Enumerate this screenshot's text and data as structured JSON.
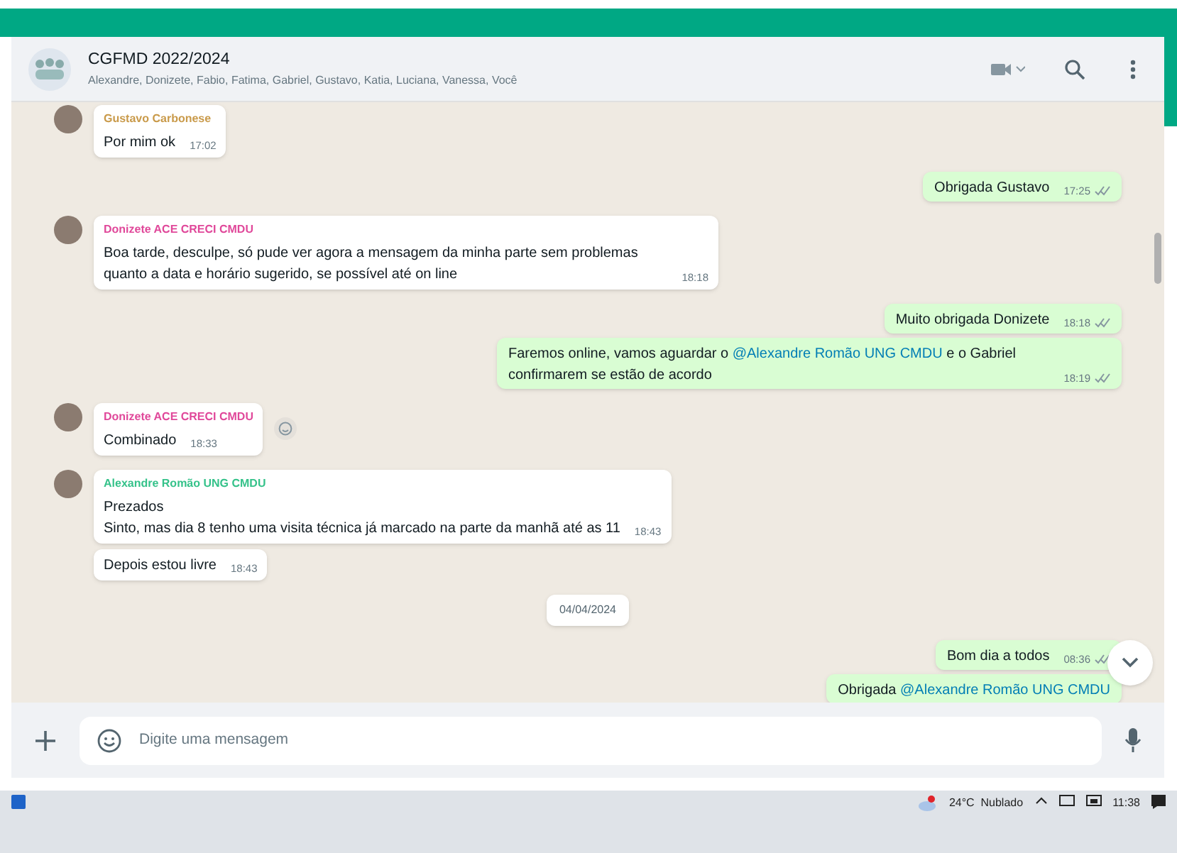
{
  "chat": {
    "title": "CGFMD 2022/2024",
    "members": "Alexandre, Donizete, Fabio, Fatima, Gabriel, Gustavo, Katia, Luciana, Vanessa, Você"
  },
  "messages": [
    {
      "kind": "incoming",
      "sender": "Gustavo Carbonese",
      "color": "#c99a4a",
      "avatar": true,
      "lines": [
        "Por mim ok"
      ],
      "time": "17:02",
      "reaction": false
    },
    {
      "kind": "outgoing",
      "parts": [
        {
          "kind": "plain",
          "text": "Obrigada Gustavo"
        }
      ],
      "time": "17:25"
    },
    {
      "kind": "incoming",
      "sender": "Donizete ACE CRECI CMDU",
      "color": "#e0489a",
      "avatar": true,
      "lines": [
        "Boa tarde, desculpe, só pude ver agora a mensagem da minha parte sem problemas quanto a data e horário sugerido, se possível até on line"
      ],
      "time": "18:18",
      "reaction": false
    },
    {
      "kind": "outgoing",
      "parts": [
        {
          "kind": "plain",
          "text": "Muito obrigada Donizete"
        }
      ],
      "time": "18:18"
    },
    {
      "kind": "outgoing",
      "parts": [
        {
          "kind": "plain",
          "text": "Faremos online, vamos aguardar o "
        },
        {
          "kind": "mention",
          "text": "@Alexandre Romão UNG CMDU"
        },
        {
          "kind": "plain",
          "text": " e o Gabriel confirmarem se estão de acordo"
        }
      ],
      "time": "18:19"
    },
    {
      "kind": "incoming",
      "sender": "Donizete ACE CRECI CMDU",
      "color": "#e0489a",
      "avatar": true,
      "lines": [
        "Combinado"
      ],
      "time": "18:33",
      "reaction": true
    },
    {
      "kind": "incoming",
      "sender": "Alexandre Romão UNG CMDU",
      "color": "#35c28a",
      "avatar": true,
      "lines": [
        "Prezados",
        "Sinto, mas dia 8 tenho uma visita técnica já marcado na parte da manhã até as 11"
      ],
      "time": "18:43",
      "reaction": false
    },
    {
      "kind": "incoming",
      "lines": [
        "Depois estou livre"
      ],
      "time": "18:43",
      "avatar": false,
      "reaction": false
    },
    {
      "kind": "date",
      "text": "04/04/2024"
    },
    {
      "kind": "outgoing",
      "parts": [
        {
          "kind": "plain",
          "text": "Bom dia a todos"
        }
      ],
      "time": "08:36"
    },
    {
      "kind": "outgoing",
      "parts": [
        {
          "kind": "plain",
          "text": "Obrigada "
        },
        {
          "kind": "mention",
          "text": "@Alexandre Romão UNG CMDU"
        }
      ]
    }
  ],
  "composer": {
    "placeholder": "Digite uma mensagem"
  },
  "taskbar": {
    "weather": "24°C  Nublado",
    "clock": "11:38"
  }
}
